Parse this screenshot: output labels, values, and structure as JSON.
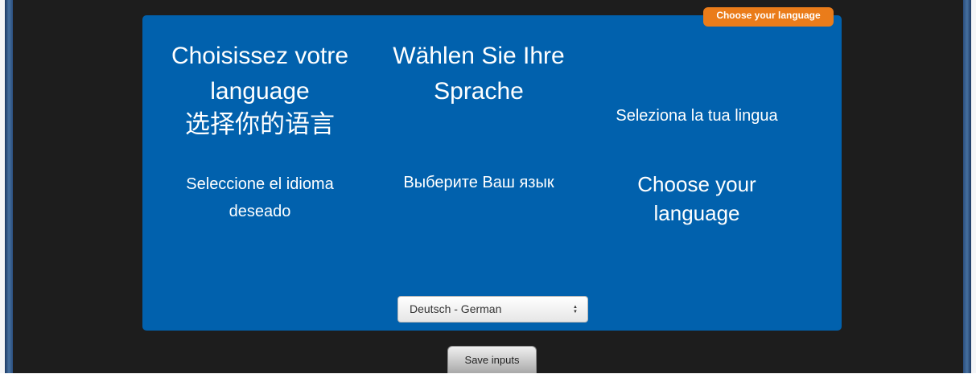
{
  "badge": {
    "label": "Choose your language"
  },
  "languages": {
    "french": [
      "Choisissez votre",
      "language"
    ],
    "german": [
      "Wählen Sie Ihre",
      "Sprache"
    ],
    "chinese": "选择你的语言",
    "italian": "Seleziona la tua lingua",
    "spanish": [
      "Seleccione el idioma",
      "deseado"
    ],
    "russian": "Выберите Ваш язык",
    "english": [
      "Choose your",
      "language"
    ]
  },
  "language_select": {
    "selected": "Deutsch - German",
    "arrow_icon": "updown-arrows-icon"
  },
  "save_button": {
    "label": "Save inputs"
  },
  "colors": {
    "panel": "#0161ad",
    "badge": "#ea7c1a",
    "background": "#1d1d1d",
    "text": "#ffffff"
  }
}
